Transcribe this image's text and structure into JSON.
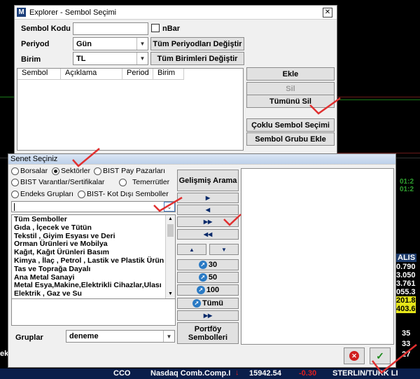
{
  "background": {
    "tickers_right": [
      "0.790",
      "3.050",
      "3.761",
      "055.3",
      "201.8",
      "403.6"
    ],
    "right_label": "ALIS",
    "right_time_1": "01:2",
    "right_time_2": "01:2",
    "right_bottom_1": "35",
    "right_bottom_2": "33",
    "right_bottom_3": "27",
    "left_bottom": "ek",
    "bottom_row": {
      "code": "CCO",
      "name": "Nasdaq Comb.Comp.I",
      "value": "15942.54",
      "change": "-0.30",
      "pair": "STERLIN/TURK LI"
    }
  },
  "explorer": {
    "title": "Explorer - Sembol Seçimi",
    "symbol_code_label": "Sembol Kodu",
    "symbol_code_value": "",
    "nbar_label": "nBar",
    "period_label": "Periyod",
    "period_value": "Gün",
    "unit_label": "Birim",
    "unit_value": "TL",
    "change_periods_button": "Tüm Periyodları Değiştir",
    "change_units_button": "Tüm Birimleri Değiştir",
    "table_columns": [
      "Sembol",
      "Açıklama",
      "Period",
      "Birim"
    ],
    "add_button": "Ekle",
    "delete_button": "Sil",
    "delete_all_button": "Tümünü Sil",
    "multi_select_button": "Çoklu Sembol Seçimi",
    "add_group_button": "Sembol Grubu Ekle"
  },
  "senet": {
    "title": "Senet Seçiniz",
    "radios": [
      {
        "label": "Borsalar",
        "selected": false
      },
      {
        "label": "Sektörler",
        "selected": true
      },
      {
        "label": "BIST Pay Pazarları",
        "selected": false
      },
      {
        "label": "BIST Varantlar/Sertifikalar",
        "selected": false
      },
      {
        "label": "Temerrütler",
        "selected": false
      },
      {
        "label": "Endeks Grupları",
        "selected": false
      },
      {
        "label": "BIST- Kot Dışı Semboller",
        "selected": false
      }
    ],
    "advanced_search_button": "Gelişmiş Arama",
    "search_value": "",
    "sectors": [
      "Tüm Semboller",
      "Gıda , İçecek ve Tütün",
      "Tekstil , Giyim Esyası ve Deri",
      "Orman Ürünleri ve Mobilya",
      "Kağıt, Kağıt Ürünleri Basım",
      "Kimya , İlaç , Petrol , Lastik ve Plastik Ürün",
      "Tas ve Toprağa Dayalı",
      "Ana Metal Sanayi",
      "Metal Esya,Makine,Elektrikli Cihazlar,Ulası",
      "Elektrik , Gaz ve Su"
    ],
    "btn_30": "30",
    "btn_50": "50",
    "btn_100": "100",
    "btn_all": "Tümü",
    "portfolio_button_line1": "Portföy",
    "portfolio_button_line2": "Sembolleri",
    "groups_label": "Gruplar",
    "groups_value": "deneme"
  }
}
